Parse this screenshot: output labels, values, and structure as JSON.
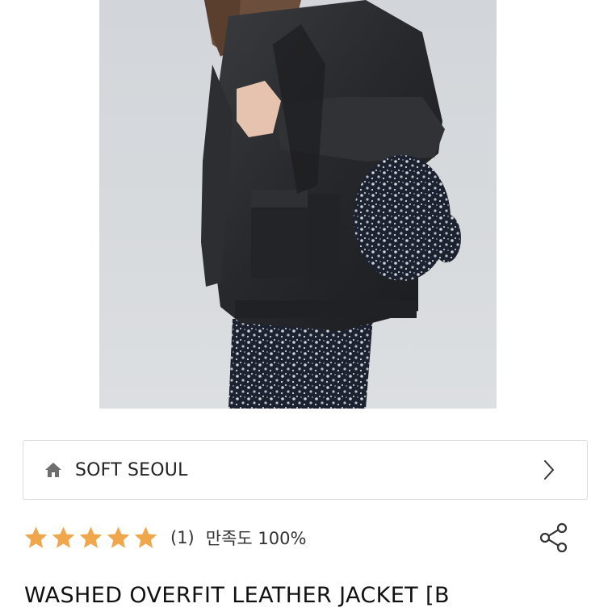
{
  "store": {
    "name": "SOFT SEOUL",
    "home_icon": "home-icon",
    "chevron_icon": "chevron-right-icon"
  },
  "rating": {
    "stars": 5,
    "star_color": "#F0A64A",
    "review_count": "(1)",
    "satisfaction": "만족도 100%"
  },
  "share": {
    "icon": "share-icon"
  },
  "product": {
    "title": "WASHED OVERFIT LEATHER JACKET [B",
    "image_alt": "model wearing black leather jacket with floral bag and floral skirt"
  }
}
